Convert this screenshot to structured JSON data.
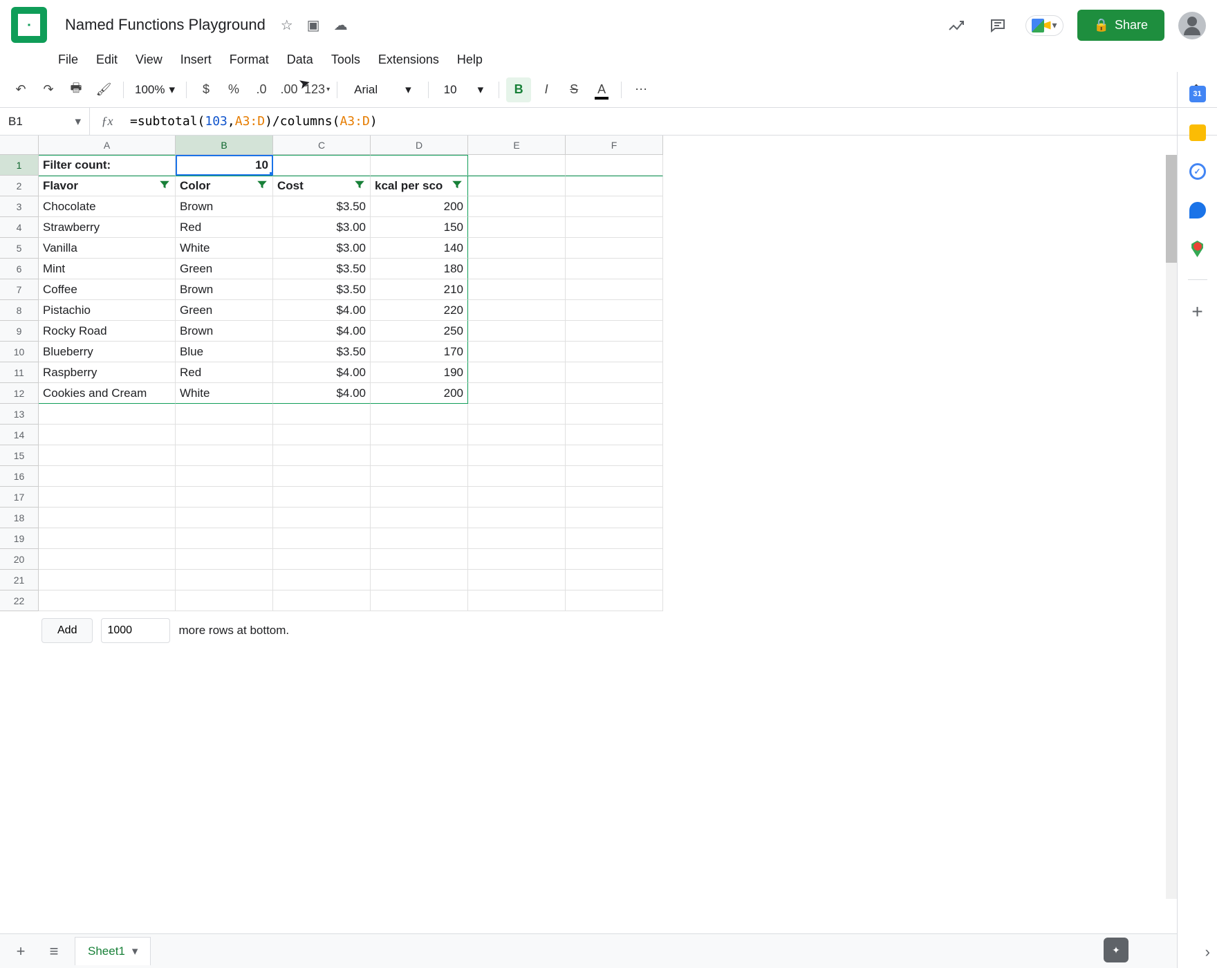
{
  "doc": {
    "title": "Named Functions Playground"
  },
  "menu": {
    "file": "File",
    "edit": "Edit",
    "view": "View",
    "insert": "Insert",
    "format": "Format",
    "data": "Data",
    "tools": "Tools",
    "extensions": "Extensions",
    "help": "Help"
  },
  "share": {
    "label": "Share"
  },
  "toolbar": {
    "zoom": "100%",
    "currency": "$",
    "percent": "%",
    "dec_dec": ".0",
    "dec_inc": ".00",
    "more_formats": "123",
    "font": "Arial",
    "font_size": "10",
    "bold": "B",
    "italic": "I",
    "strike": "S",
    "color": "A",
    "more": "⋯"
  },
  "name_box": "B1",
  "formula": {
    "prefix": "=subtotal(",
    "num": "103",
    "comma": ",",
    "range1": "A3:D",
    "mid": ")/columns(",
    "range2": "A3:D",
    "suffix": ")"
  },
  "columns": [
    "A",
    "B",
    "C",
    "D",
    "E",
    "F"
  ],
  "row_count": 22,
  "table": {
    "label_cell": "Filter count:",
    "value_cell": "10",
    "headers": {
      "a": "Flavor",
      "b": "Color",
      "c": "Cost",
      "d": "kcal per sco"
    },
    "rows": [
      {
        "flavor": "Chocolate",
        "color": "Brown",
        "cost": "$3.50",
        "kcal": "200"
      },
      {
        "flavor": "Strawberry",
        "color": "Red",
        "cost": "$3.00",
        "kcal": "150"
      },
      {
        "flavor": "Vanilla",
        "color": "White",
        "cost": "$3.00",
        "kcal": "140"
      },
      {
        "flavor": "Mint",
        "color": "Green",
        "cost": "$3.50",
        "kcal": "180"
      },
      {
        "flavor": "Coffee",
        "color": "Brown",
        "cost": "$3.50",
        "kcal": "210"
      },
      {
        "flavor": "Pistachio",
        "color": "Green",
        "cost": "$4.00",
        "kcal": "220"
      },
      {
        "flavor": "Rocky Road",
        "color": "Brown",
        "cost": "$4.00",
        "kcal": "250"
      },
      {
        "flavor": "Blueberry",
        "color": "Blue",
        "cost": "$3.50",
        "kcal": "170"
      },
      {
        "flavor": "Raspberry",
        "color": "Red",
        "cost": "$4.00",
        "kcal": "190"
      },
      {
        "flavor": "Cookies and Cream",
        "color": "White",
        "cost": "$4.00",
        "kcal": "200"
      }
    ]
  },
  "add_rows": {
    "button": "Add",
    "count": "1000",
    "suffix": "more rows at bottom."
  },
  "sheet": {
    "name": "Sheet1"
  }
}
